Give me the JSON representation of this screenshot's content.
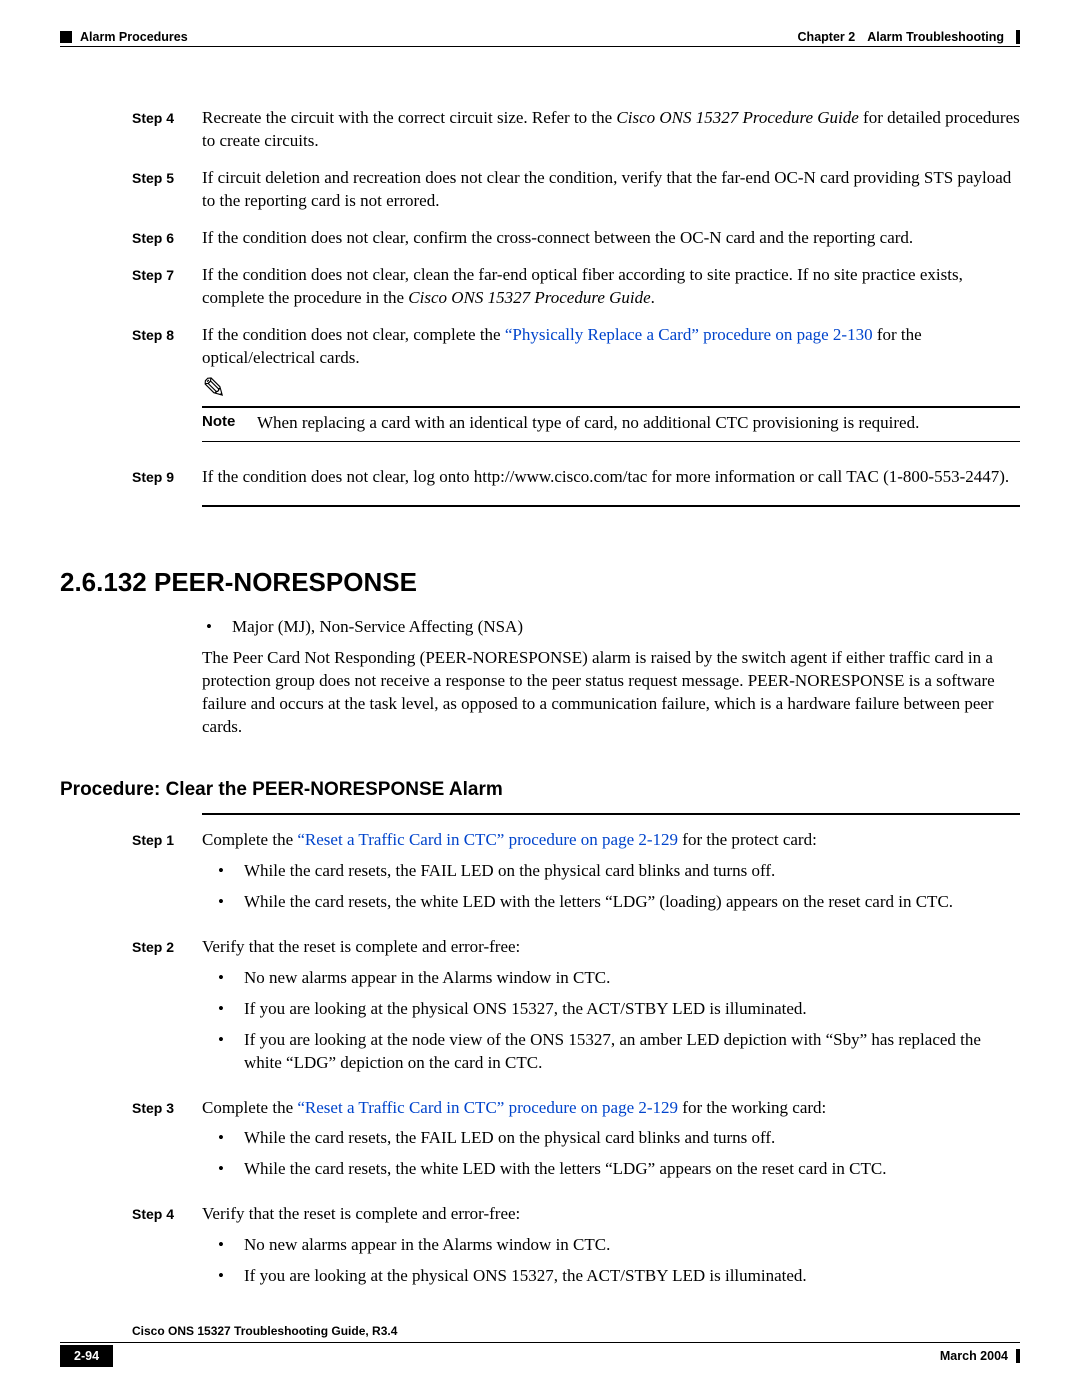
{
  "header": {
    "section_label": "Alarm Procedures",
    "chapter_label": "Chapter 2",
    "chapter_title": "Alarm Troubleshooting"
  },
  "steps_a": {
    "s4": {
      "label": "Step 4",
      "t1": "Recreate the circuit with the correct circuit size. Refer to the ",
      "it1": "Cisco ONS 15327 Procedure Guide",
      "t2": " for detailed procedures to create circuits."
    },
    "s5": {
      "label": "Step 5",
      "text": "If circuit deletion and recreation does not clear the condition, verify that the far-end OC-N card providing STS payload to the reporting card is not errored."
    },
    "s6": {
      "label": "Step 6",
      "text": "If the condition does not clear, confirm the cross-connect between the OC-N card and the reporting card."
    },
    "s7": {
      "label": "Step 7",
      "t1": "If the condition does not clear, clean the far-end optical fiber according to site practice. If no site practice exists, complete the procedure in the ",
      "it1": "Cisco ONS 15327 Procedure Guide",
      "t2": "."
    },
    "s8": {
      "label": "Step 8",
      "t1": "If the condition does not clear, complete the ",
      "link": "“Physically Replace a Card” procedure on page 2-130",
      "t2": " for the optical/electrical cards."
    },
    "note": {
      "label": "Note",
      "text": "When replacing a card with an identical type of card, no additional CTC provisioning is required."
    },
    "s9": {
      "label": "Step 9",
      "text": "If the condition does not clear, log onto http://www.cisco.com/tac for more information or call TAC (1-800-553-2447)."
    }
  },
  "section": {
    "heading": "2.6.132  PEER-NORESPONSE",
    "bullet1": "Major (MJ), Non-Service Affecting (NSA)",
    "para1": "The Peer Card Not Responding (PEER-NORESPONSE) alarm is raised by the switch agent if either traffic card in a protection group does not receive a response to the peer status request message. PEER-NORESPONSE is a software failure and occurs at the task level, as opposed to a communication failure, which is a hardware failure between peer cards.",
    "proc_heading": "Procedure: Clear the PEER-NORESPONSE Alarm"
  },
  "steps_b": {
    "s1": {
      "label": "Step 1",
      "t1": "Complete the ",
      "link": "“Reset a Traffic Card in CTC” procedure on page 2-129",
      "t2": " for the protect card:",
      "b1": "While the card resets, the FAIL LED on the physical card blinks and turns off.",
      "b2": "While the card resets, the white LED with the letters “LDG” (loading) appears on the reset card in CTC."
    },
    "s2": {
      "label": "Step 2",
      "text": "Verify that the reset is complete and error-free:",
      "b1": "No new alarms appear in the Alarms window in CTC.",
      "b2": "If you are looking at the physical ONS 15327, the ACT/STBY LED is illuminated.",
      "b3": "If you are looking at the node view of the ONS 15327, an amber LED depiction with “Sby” has replaced the white “LDG” depiction on the card in CTC."
    },
    "s3": {
      "label": "Step 3",
      "t1": "Complete the ",
      "link": "“Reset a Traffic Card in CTC” procedure on page 2-129",
      "t2": " for the working card:",
      "b1": "While the card resets, the FAIL LED on the physical card blinks and turns off.",
      "b2": "While the card resets, the white LED with the letters “LDG” appears on the reset card in CTC."
    },
    "s4": {
      "label": "Step 4",
      "text": "Verify that the reset is complete and error-free:",
      "b1": "No new alarms appear in the Alarms window in CTC.",
      "b2": "If you are looking at the physical ONS 15327, the ACT/STBY LED is illuminated."
    }
  },
  "footer": {
    "title": "Cisco ONS 15327 Troubleshooting Guide, R3.4",
    "page": "2-94",
    "date": "March 2004"
  }
}
